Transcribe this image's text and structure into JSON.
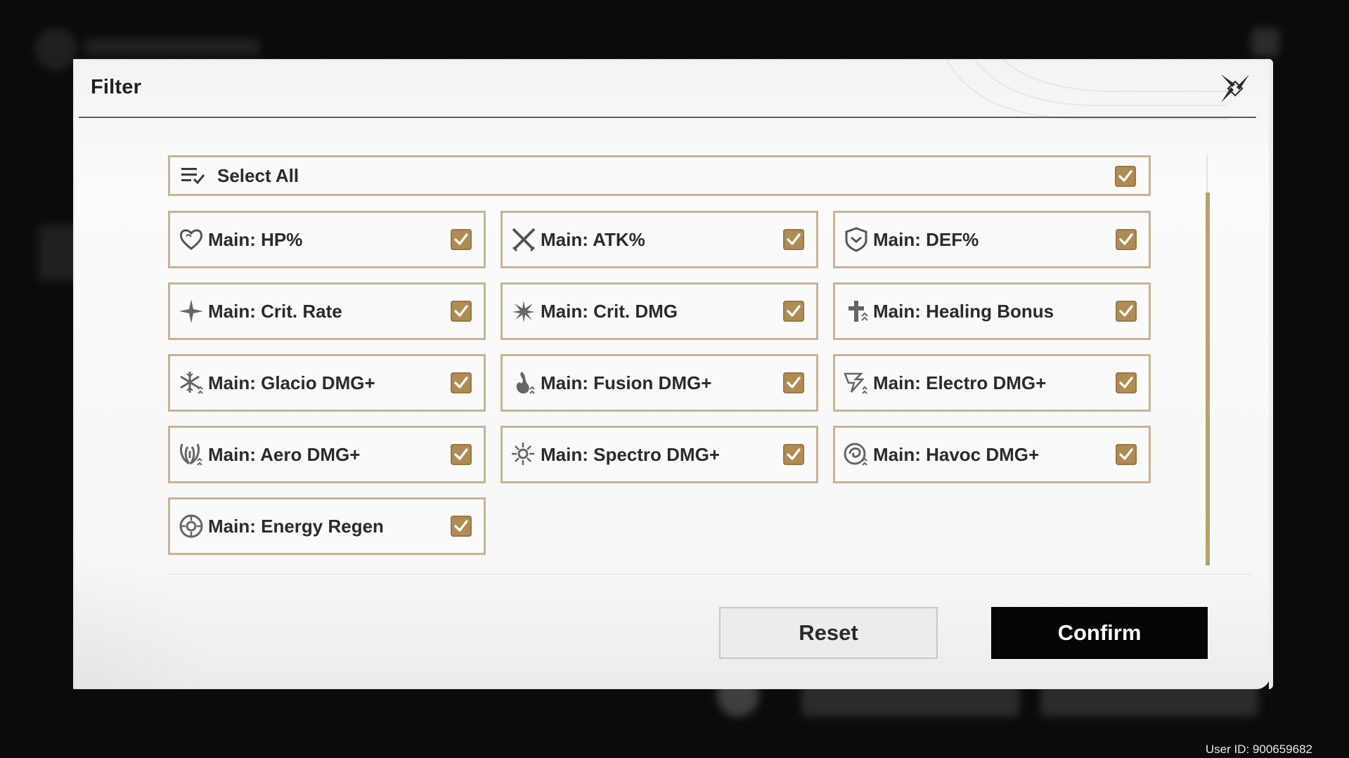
{
  "dialog": {
    "title": "Filter",
    "close_icon": "close-x-icon"
  },
  "select_all": {
    "label": "Select All",
    "checked": true,
    "icon": "list-check-icon"
  },
  "options": [
    {
      "label": "Main: HP%",
      "icon": "heart-icon",
      "checked": true
    },
    {
      "label": "Main: ATK%",
      "icon": "crossed-swords-icon",
      "checked": true
    },
    {
      "label": "Main: DEF%",
      "icon": "shield-icon",
      "checked": true
    },
    {
      "label": "Main: Crit. Rate",
      "icon": "crit-star-icon",
      "checked": true
    },
    {
      "label": "Main: Crit. DMG",
      "icon": "crit-burst-icon",
      "checked": true
    },
    {
      "label": "Main: Healing Bonus",
      "icon": "healing-icon",
      "checked": true
    },
    {
      "label": "Main: Glacio DMG+",
      "icon": "snowflake-icon",
      "checked": true
    },
    {
      "label": "Main: Fusion DMG+",
      "icon": "flame-icon",
      "checked": true
    },
    {
      "label": "Main: Electro DMG+",
      "icon": "lightning-icon",
      "checked": true
    },
    {
      "label": "Main: Aero DMG+",
      "icon": "wind-icon",
      "checked": true
    },
    {
      "label": "Main: Spectro DMG+",
      "icon": "sun-icon",
      "checked": true
    },
    {
      "label": "Main: Havoc DMG+",
      "icon": "vortex-icon",
      "checked": true
    },
    {
      "label": "Main: Energy Regen",
      "icon": "energy-ring-icon",
      "checked": true
    }
  ],
  "buttons": {
    "reset": "Reset",
    "confirm": "Confirm"
  },
  "footer": {
    "user_id": "User ID: 900659682"
  },
  "colors": {
    "accent": "#b08c55",
    "border": "#c9b394",
    "confirm_bg": "#050505",
    "scroll_thumb": "#b9a16d"
  }
}
